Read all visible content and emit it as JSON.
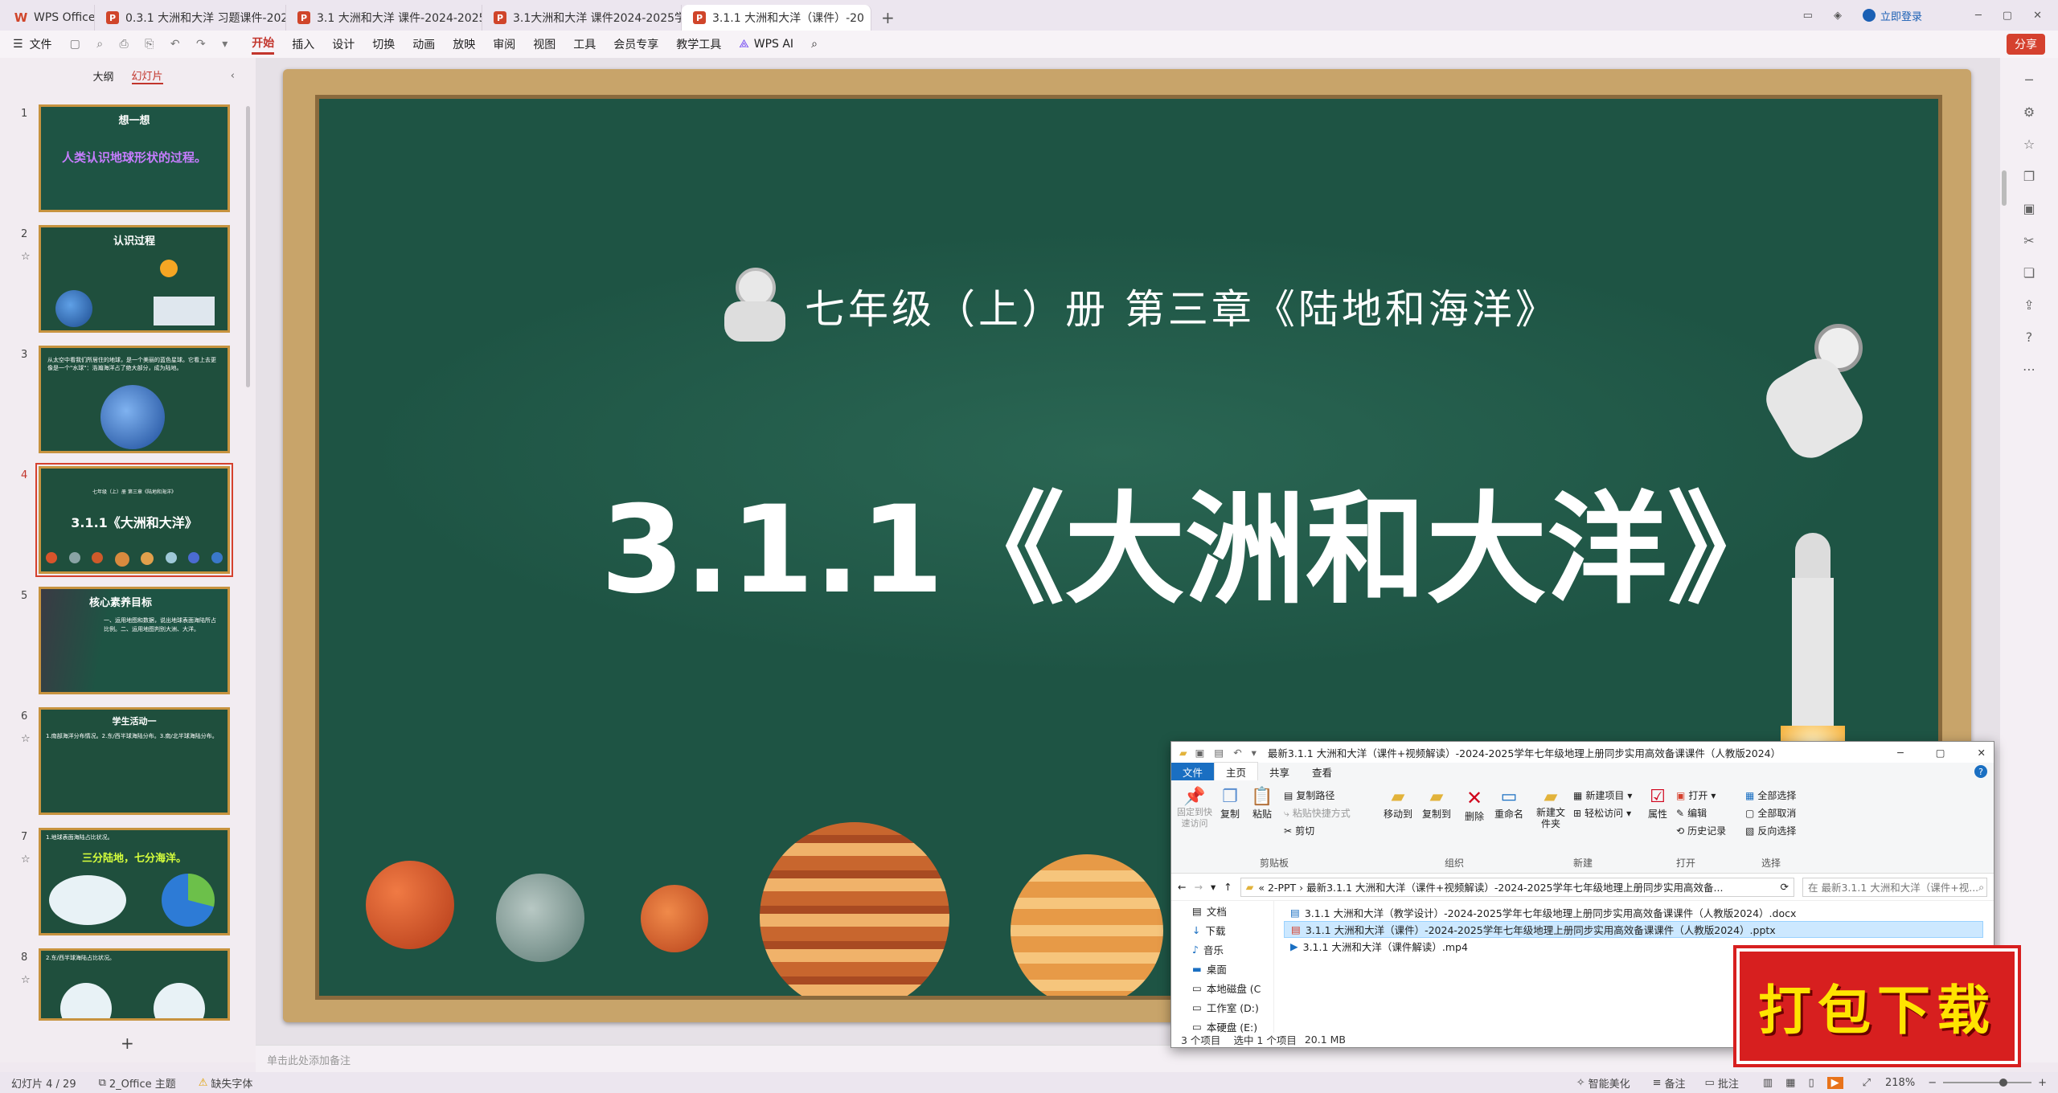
{
  "titlebar": {
    "tabs": [
      {
        "label": "WPS Office",
        "active": false
      },
      {
        "label": "0.3.1 大洲和大洋 习题课件-2024-20",
        "active": false
      },
      {
        "label": "3.1 大洲和大洋 课件-2024-2025年",
        "active": false
      },
      {
        "label": "3.1大洲和大洋 课件2024-2025学年人",
        "active": false
      },
      {
        "label": "3.1.1 大洲和大洋（课件）-20",
        "active": true
      }
    ],
    "login": "立即登录",
    "add_tab": "+"
  },
  "menubar": {
    "file": "文件",
    "items": [
      "开始",
      "插入",
      "设计",
      "切换",
      "动画",
      "放映",
      "审阅",
      "视图",
      "工具",
      "会员专享",
      "教学工具"
    ],
    "ai": "WPS AI",
    "share": "分享"
  },
  "leftpanel": {
    "tab_outline": "大纲",
    "tab_slides": "幻灯片",
    "add": "+",
    "slides": [
      {
        "num": "1",
        "title": "想一想",
        "body": "人类认识地球形状的过程。"
      },
      {
        "num": "2",
        "title": "认识过程",
        "body": ""
      },
      {
        "num": "3",
        "title": "",
        "body": "从太空中看我们所居住的地球，是一个美丽的蓝色星球。它看上去更像是一个\"水球\"：浩瀚海洋占了绝大部分，成为陆地。"
      },
      {
        "num": "4",
        "title": "3.1.1《大洲和大洋》",
        "body": "七年级（上）册 第三章《陆地和海洋》"
      },
      {
        "num": "5",
        "title": "核心素养目标",
        "body": "一、运用地图和数据，说出地球表面海陆所占比例。二、运用地图判别大洲、大洋。"
      },
      {
        "num": "6",
        "title": "学生活动一",
        "body": "1.南部海洋分布情况。2.东/西半球海陆分布。3.南/北半球海陆分布。"
      },
      {
        "num": "7",
        "title": "三分陆地，七分海洋。",
        "body": "1.地球表面海陆占比状况。"
      },
      {
        "num": "8",
        "title": "",
        "body": "2.东/西半球海陆占比状况。"
      }
    ]
  },
  "slide": {
    "subtitle": "七年级（上）册 第三章《陆地和海洋》",
    "title": "3.1.1《大洲和大洋》"
  },
  "notes_placeholder": "单击此处添加备注",
  "statusbar": {
    "slide_count": "幻灯片 4 / 29",
    "theme": "2_Office 主题",
    "missing_font": "缺失字体",
    "beautify": "智能美化",
    "notes": "备注",
    "comments": "批注",
    "zoom": "218%"
  },
  "explorer": {
    "title": "最新3.1.1 大洲和大洋（课件+视频解读）-2024-2025学年七年级地理上册同步实用高效备课课件（人教版2024）",
    "tabs": [
      "文件",
      "主页",
      "共享",
      "查看"
    ],
    "ribbon": {
      "pin": "固定到快速访问",
      "copy": "复制",
      "paste": "粘贴",
      "copy_path": "复制路径",
      "paste_shortcut": "粘贴快捷方式",
      "cut": "剪切",
      "move_to": "移动到",
      "copy_to": "复制到",
      "delete": "删除",
      "rename": "重命名",
      "new_folder": "新建文件夹",
      "new_item": "新建项目",
      "easy_access": "轻松访问",
      "properties": "属性",
      "open": "打开",
      "edit": "编辑",
      "history": "历史记录",
      "select_all": "全部选择",
      "select_none": "全部取消",
      "invert": "反向选择",
      "groups": [
        "剪贴板",
        "组织",
        "新建",
        "打开",
        "选择"
      ]
    },
    "address": "« 2-PPT › 最新3.1.1 大洲和大洋（课件+视频解读）-2024-2025学年七年级地理上册同步实用高效备...",
    "search_placeholder": "在 最新3.1.1 大洲和大洋（课件+视...",
    "nav": [
      "文档",
      "下载",
      "音乐",
      "桌面",
      "本地磁盘 (C",
      "工作室 (D:)",
      "本硬盘 (E:)"
    ],
    "files": [
      {
        "name": "3.1.1 大洲和大洋（教学设计）-2024-2025学年七年级地理上册同步实用高效备课课件（人教版2024）.docx",
        "selected": false
      },
      {
        "name": "3.1.1 大洲和大洋（课件）-2024-2025学年七年级地理上册同步实用高效备课课件（人教版2024）.pptx",
        "selected": true
      },
      {
        "name": "3.1.1 大洲和大洋（课件解读）.mp4",
        "selected": false
      }
    ],
    "status_count": "3 个项目",
    "status_selected": "选中 1 个项目",
    "status_size": "20.1 MB"
  },
  "download_stamp": "打包下载",
  "colors": {
    "accent": "#c2352c",
    "board": "#1e5444",
    "frame": "#c8a46a",
    "stamp": "#d71f1f",
    "stamp_text": "#ffe400"
  }
}
